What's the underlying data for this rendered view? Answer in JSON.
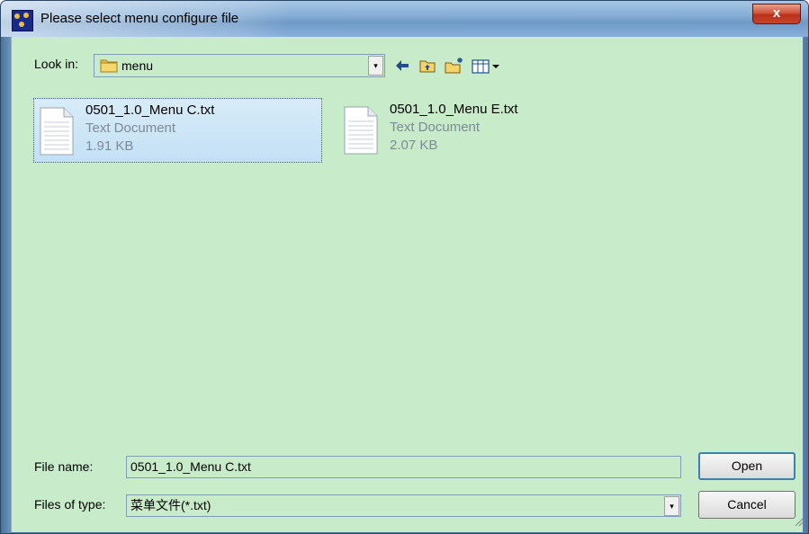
{
  "window": {
    "title": "Please select menu configure file",
    "close_label": "x"
  },
  "toolbar": {
    "look_in_label": "Look in:",
    "look_in_value": "menu",
    "dropdown_glyph": "▾",
    "back_icon": "back-arrow-icon",
    "up_icon": "up-folder-icon",
    "new_folder_icon": "new-folder-icon",
    "view_menu_icon": "view-menu-icon"
  },
  "files": [
    {
      "name": "0501_1.0_Menu C.txt",
      "type": "Text Document",
      "size": "1.91 KB",
      "selected": true
    },
    {
      "name": "0501_1.0_Menu E.txt",
      "type": "Text Document",
      "size": "2.07 KB",
      "selected": false
    }
  ],
  "footer": {
    "file_name_label": "File name:",
    "file_name_value": "0501_1.0_Menu C.txt",
    "file_type_label": "Files of type:",
    "file_type_value": "菜单文件(*.txt)",
    "open_label": "Open",
    "cancel_label": "Cancel"
  },
  "colors": {
    "client_background": "#c8ecc9",
    "title_bar": "#86aed6",
    "close_button": "#c9442c"
  }
}
